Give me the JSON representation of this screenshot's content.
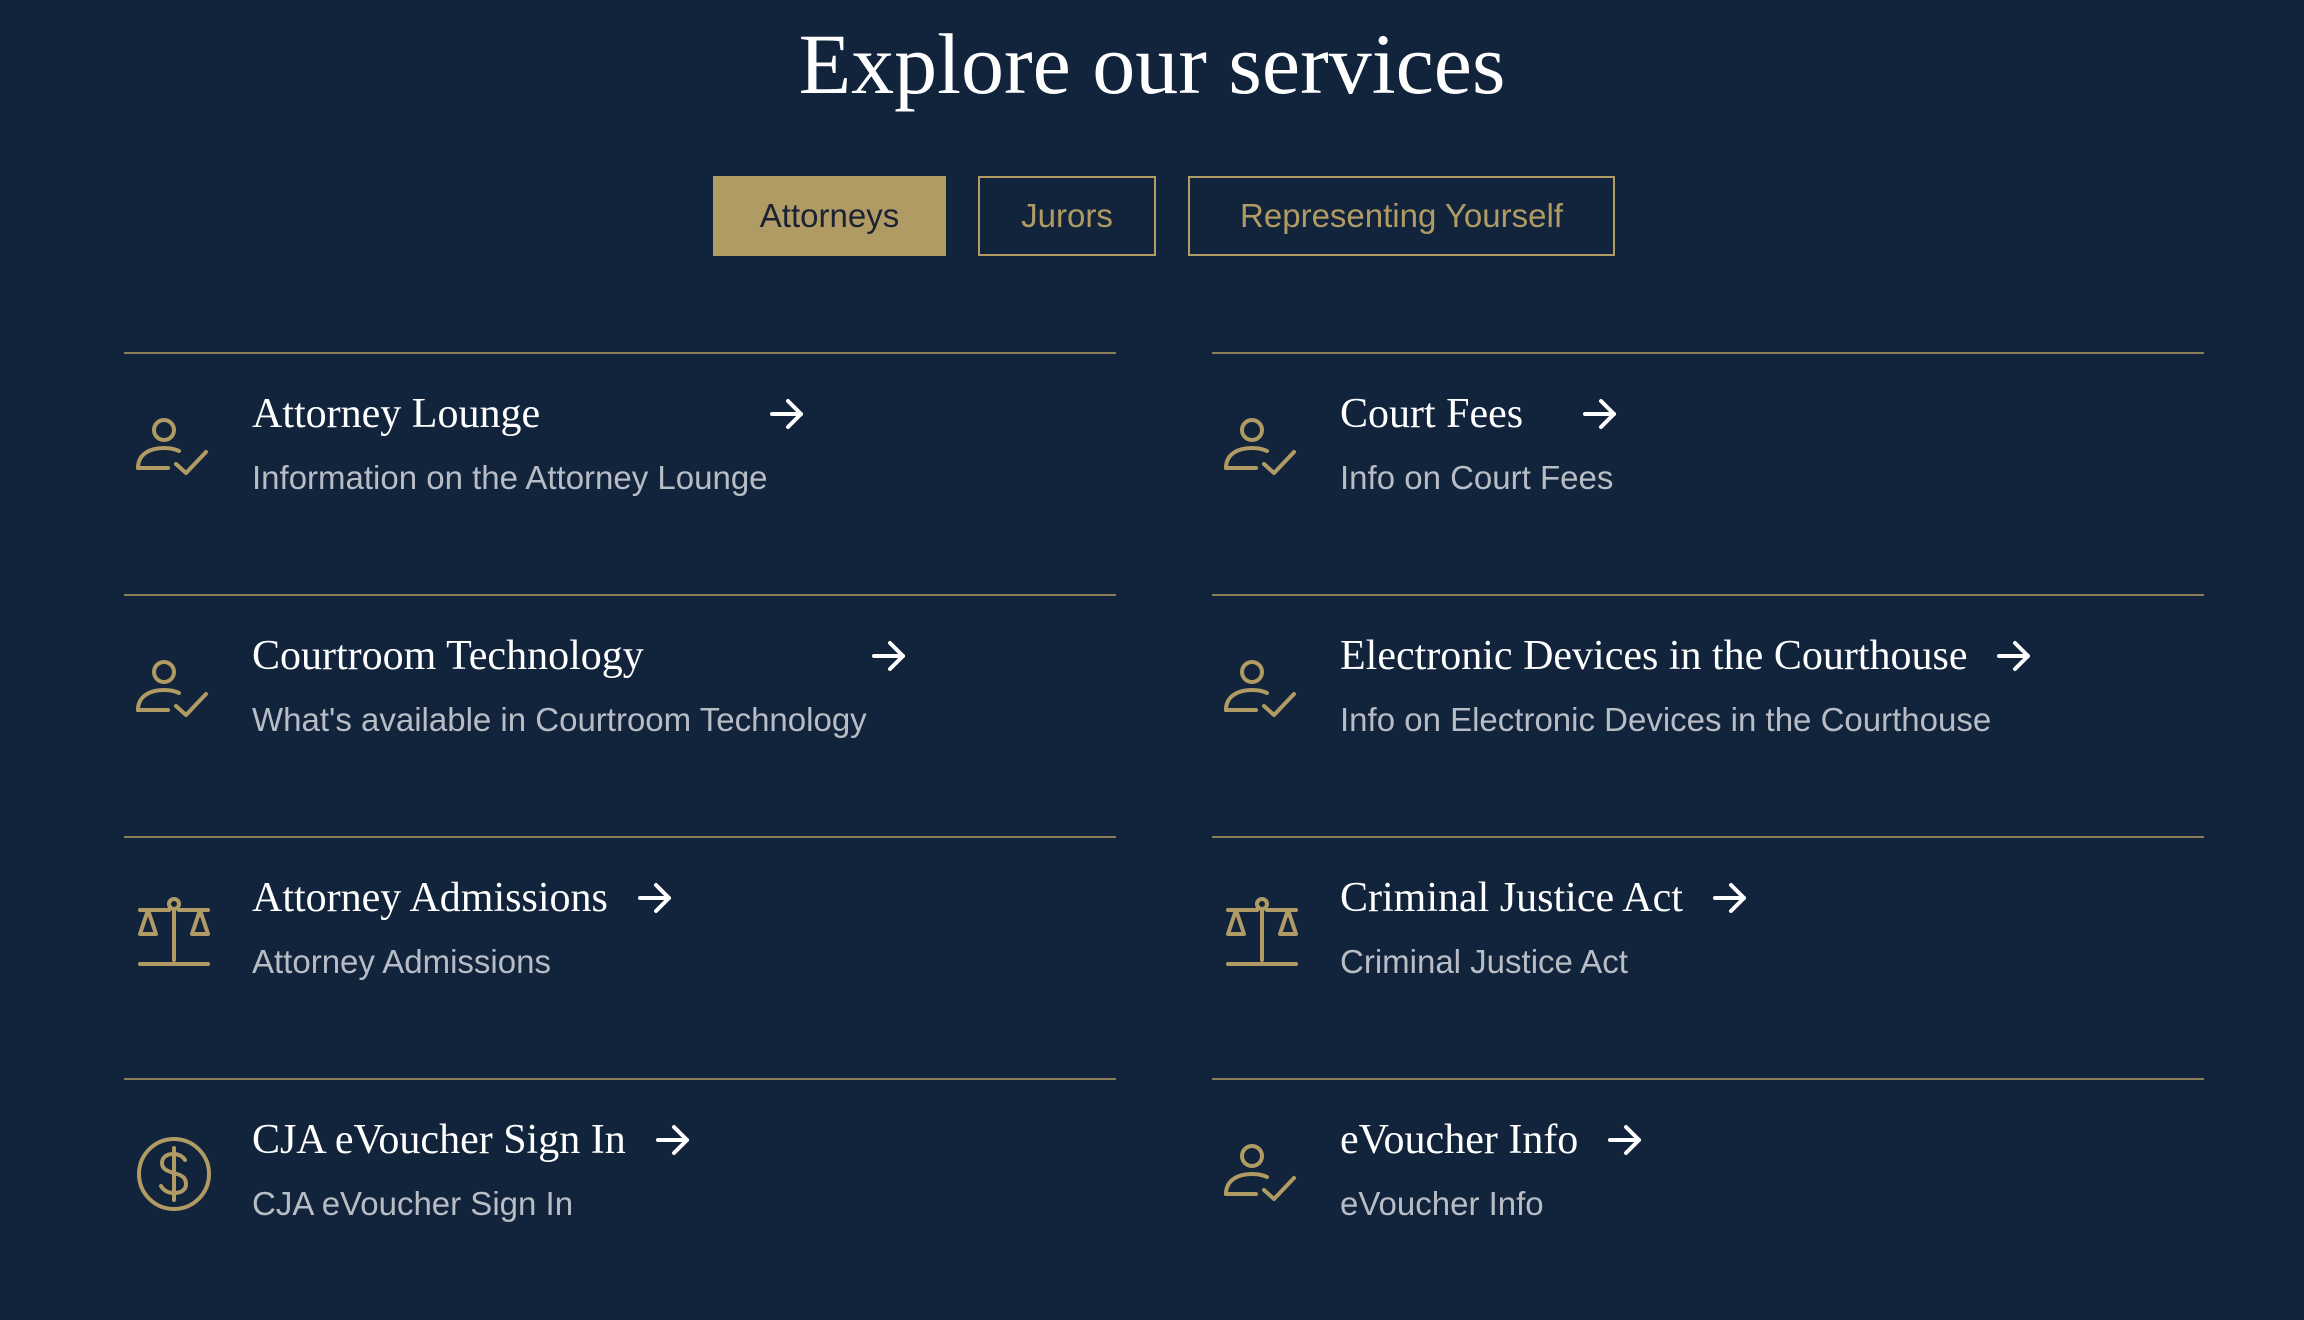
{
  "page": {
    "title": "Explore our services"
  },
  "tabs": [
    {
      "label": "Attorneys",
      "active": true
    },
    {
      "label": "Jurors",
      "active": false
    },
    {
      "label": "Representing Yourself",
      "active": false
    }
  ],
  "services": [
    {
      "title": "Attorney Lounge",
      "desc": "Information on the Attorney Lounge",
      "icon": "person-check-icon"
    },
    {
      "title": "Court Fees",
      "desc": "Info on Court Fees",
      "icon": "person-check-icon"
    },
    {
      "title": "Courtroom Technology",
      "desc": "What's available in Courtroom Technology",
      "icon": "person-check-icon"
    },
    {
      "title": "Electronic Devices in the Courthouse",
      "desc": "Info on Electronic Devices in the Courthouse",
      "icon": "person-check-icon"
    },
    {
      "title": "Attorney Admissions",
      "desc": "Attorney Admissions",
      "icon": "scales-icon"
    },
    {
      "title": "Criminal Justice Act",
      "desc": "Criminal Justice Act",
      "icon": "scales-icon"
    },
    {
      "title": "CJA eVoucher Sign In",
      "desc": "CJA eVoucher Sign In",
      "icon": "dollar-circle-icon"
    },
    {
      "title": "eVoucher Info",
      "desc": "eVoucher Info",
      "icon": "person-check-icon"
    }
  ],
  "colors": {
    "background": "#11243c",
    "accent": "#b19b64",
    "text": "#ffffff",
    "muted_text": "#b8bcc5"
  }
}
